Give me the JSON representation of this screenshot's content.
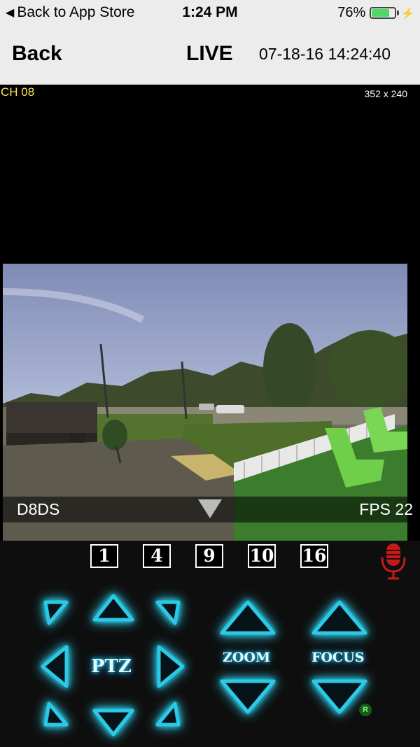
{
  "status_bar": {
    "back_to_app": "Back to App Store",
    "time": "1:24 PM",
    "battery_percent": "76%",
    "battery_level": 0.76,
    "battery_color": "#4cd964"
  },
  "nav": {
    "back_label": "Back",
    "title": "LIVE",
    "datetime": "07-18-16 14:24:40"
  },
  "video": {
    "channel": "CH 08",
    "resolution": "352 x 240",
    "device_name": "D8DS",
    "fps": "FPS 22"
  },
  "grid_buttons": [
    "1",
    "4",
    "9",
    "10",
    "16"
  ],
  "controls": {
    "ptz_label": "PTZ",
    "zoom_label": "ZOOM",
    "focus_label": "FOCUS",
    "badge": "R",
    "accent_color": "#2cc9e6",
    "mic_color": "#c41a1a"
  }
}
